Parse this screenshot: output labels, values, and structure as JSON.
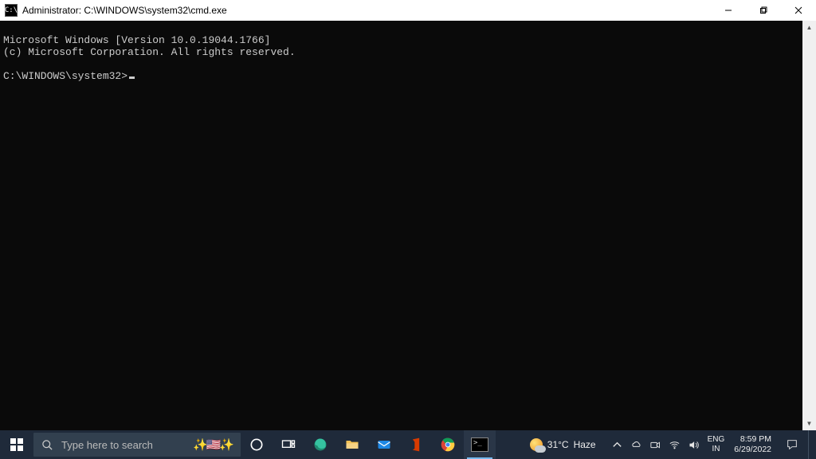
{
  "window": {
    "title": "Administrator: C:\\WINDOWS\\system32\\cmd.exe",
    "icon_label": "C:\\"
  },
  "terminal": {
    "line1": "Microsoft Windows [Version 10.0.19044.1766]",
    "line2": "(c) Microsoft Corporation. All rights reserved.",
    "blank": "",
    "prompt": "C:\\WINDOWS\\system32>"
  },
  "taskbar": {
    "search_placeholder": "Type here to search",
    "apps": {
      "cortana": "cortana-icon",
      "taskview": "task-view-icon",
      "edge": "edge-icon",
      "explorer": "file-explorer-icon",
      "mail": "mail-icon",
      "office": "office-icon",
      "chrome": "chrome-icon",
      "cmd": "cmd-icon"
    }
  },
  "systray": {
    "weather_temp": "31°C",
    "weather_desc": "Haze",
    "lang_top": "ENG",
    "lang_bottom": "IN",
    "time": "8:59 PM",
    "date": "6/29/2022"
  }
}
